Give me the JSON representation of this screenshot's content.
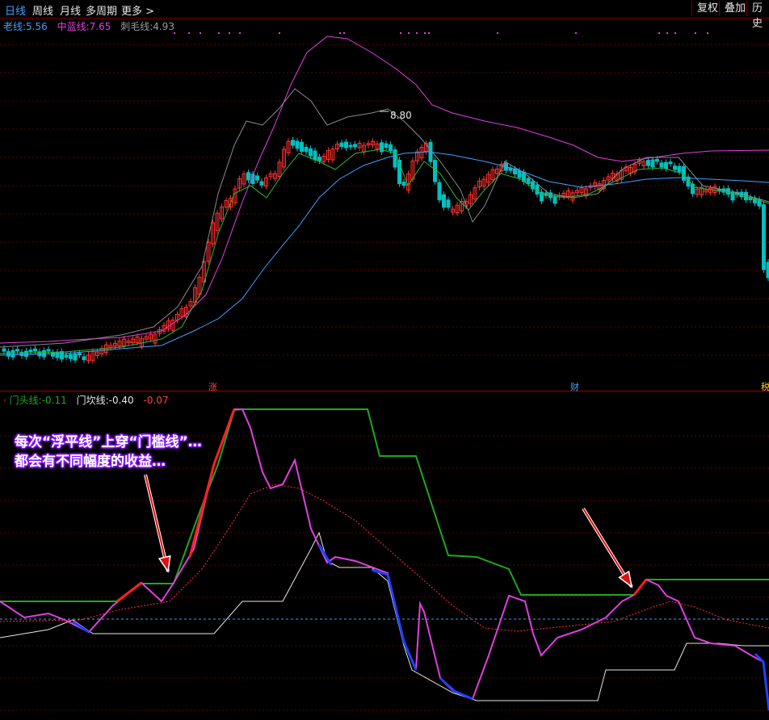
{
  "toolbar": {
    "tabs": [
      "日线",
      "周线",
      "月线",
      "多周期",
      "更多"
    ],
    "more_chevron": "chevron-right-icon",
    "right_buttons": [
      "复权",
      "叠加",
      "历史"
    ]
  },
  "main_legend": {
    "items": [
      {
        "label": "老线:",
        "value": "5.56",
        "color": "#3fa0ff"
      },
      {
        "label": "中蓝线:",
        "value": "7.65",
        "color": "#e040e0"
      },
      {
        "label": "刺毛线:",
        "value": "4.93",
        "color": "#9a9a9a"
      }
    ]
  },
  "price_annotation": "8.80",
  "event_markers": [
    {
      "text": "涨",
      "color": "#ff4040"
    },
    {
      "text": "财",
      "color": "#3fa0ff"
    },
    {
      "text": "税",
      "color": "#ffcc00"
    }
  ],
  "sub_legend": {
    "items": [
      {
        "label": "门头线:",
        "value": "-0.11",
        "color": "#1fa81f"
      },
      {
        "label": "门坎线:",
        "value": "-0.40",
        "color": "#e6e6e6"
      },
      {
        "label": "",
        "value": "-0.07",
        "color": "#ff4040"
      }
    ]
  },
  "annotation": {
    "line1": "每次“浮平线”上穿“门槛线”…",
    "line2": "都会有不同幅度的收益…"
  },
  "colors": {
    "up": "#ff3030",
    "down": "#00c0c0",
    "grid": "#7a0000",
    "magenta": "#e040e0",
    "blue_ma": "#3fa0ff",
    "green_ma": "#2db82d"
  }
}
